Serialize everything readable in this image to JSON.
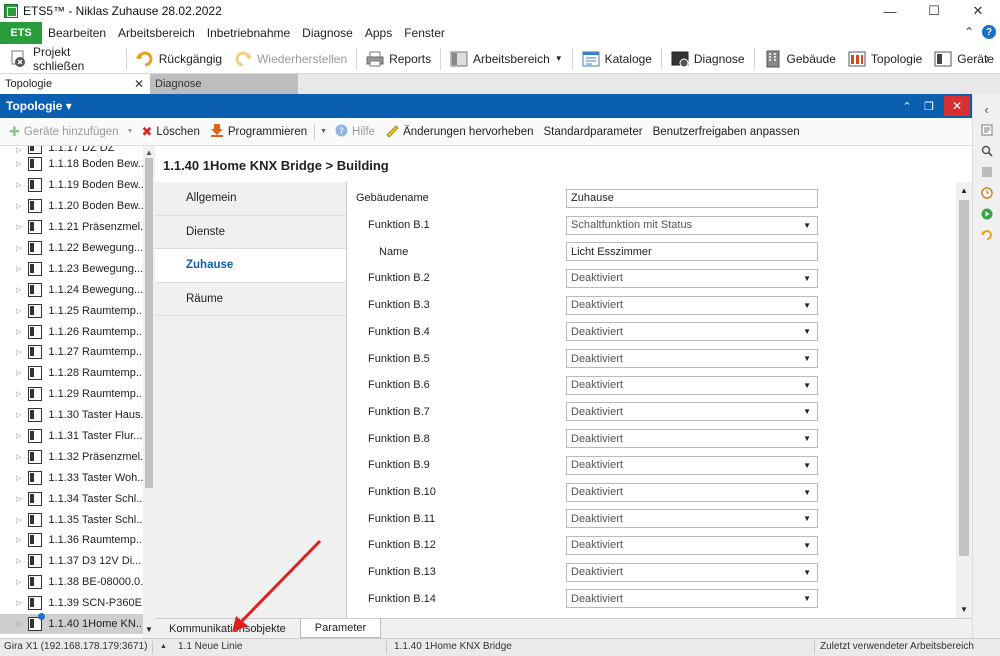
{
  "window": {
    "title": "ETS5™ - Niklas Zuhause 28.02.2022",
    "minimize": "—",
    "maximize": "☐",
    "close": "✕"
  },
  "menu": {
    "ets_tab": "ETS",
    "items": [
      "Bearbeiten",
      "Arbeitsbereich",
      "Inbetriebnahme",
      "Diagnose",
      "Apps",
      "Fenster"
    ],
    "collapse": "⌃",
    "help": "?"
  },
  "ribbon": {
    "close_project": "Projekt schließen",
    "undo": "Rückgängig",
    "redo": "Wiederherstellen",
    "reports": "Reports",
    "workspace": "Arbeitsbereich",
    "catalogs": "Kataloge",
    "diagnose": "Diagnose",
    "buildings": "Gebäude",
    "topology": "Topologie",
    "devices": "Geräte",
    "more": "›"
  },
  "doctabs": {
    "active": "Topologie",
    "active_close": "✕",
    "inactive": "Diagnose"
  },
  "panel": {
    "title": "Topologie ▾",
    "collapse": "⌃",
    "restore": "❐",
    "close": "✕"
  },
  "toolbar": {
    "add_devices": "Geräte hinzufügen",
    "delete": "Löschen",
    "program": "Programmieren",
    "help": "Hilfe",
    "highlight_changes": "Änderungen hervorheben",
    "default_params": "Standardparameter",
    "user_approvals": "Benutzerfreigaben anpassen"
  },
  "tree": {
    "partial_top": "1.1.17 DZ DZ",
    "items": [
      "1.1.18 Boden Bew...",
      "1.1.19 Boden Bew...",
      "1.1.20 Boden Bew...",
      "1.1.21 Präsenzmel...",
      "1.1.22 Bewegung...",
      "1.1.23 Bewegung...",
      "1.1.24 Bewegung...",
      "1.1.25 Raumtemp...",
      "1.1.26 Raumtemp...",
      "1.1.27 Raumtemp...",
      "1.1.28 Raumtemp...",
      "1.1.29 Raumtemp...",
      "1.1.30 Taster Haus...",
      "1.1.31 Taster Flur...",
      "1.1.32 Präsenzmel...",
      "1.1.33 Taster Woh...",
      "1.1.34 Taster Schl...",
      "1.1.35 Taster Schl...",
      "1.1.36 Raumtemp...",
      "1.1.37 D3 12V Di...",
      "1.1.38 BE-08000.0...",
      "1.1.39 SCN-P360E...",
      "1.1.40 1Home KN..."
    ]
  },
  "content": {
    "title": "1.1.40 1Home KNX Bridge > Building",
    "nav": [
      "Allgemein",
      "Dienste",
      "Zuhause",
      "Räume"
    ],
    "params": [
      {
        "label": "Gebäudename",
        "value": "Zuhause",
        "type": "text",
        "indent": 0
      },
      {
        "label": "Funktion B.1",
        "value": "Schaltfunktion mit Status",
        "type": "select",
        "indent": 1
      },
      {
        "label": "Name",
        "value": "Licht Esszimmer",
        "type": "text",
        "indent": 2
      },
      {
        "label": "Funktion B.2",
        "value": "Deaktiviert",
        "type": "select",
        "indent": 1
      },
      {
        "label": "Funktion B.3",
        "value": "Deaktiviert",
        "type": "select",
        "indent": 1
      },
      {
        "label": "Funktion B.4",
        "value": "Deaktiviert",
        "type": "select",
        "indent": 1
      },
      {
        "label": "Funktion B.5",
        "value": "Deaktiviert",
        "type": "select",
        "indent": 1
      },
      {
        "label": "Funktion B.6",
        "value": "Deaktiviert",
        "type": "select",
        "indent": 1
      },
      {
        "label": "Funktion B.7",
        "value": "Deaktiviert",
        "type": "select",
        "indent": 1
      },
      {
        "label": "Funktion B.8",
        "value": "Deaktiviert",
        "type": "select",
        "indent": 1
      },
      {
        "label": "Funktion B.9",
        "value": "Deaktiviert",
        "type": "select",
        "indent": 1
      },
      {
        "label": "Funktion B.10",
        "value": "Deaktiviert",
        "type": "select",
        "indent": 1
      },
      {
        "label": "Funktion B.11",
        "value": "Deaktiviert",
        "type": "select",
        "indent": 1
      },
      {
        "label": "Funktion B.12",
        "value": "Deaktiviert",
        "type": "select",
        "indent": 1
      },
      {
        "label": "Funktion B.13",
        "value": "Deaktiviert",
        "type": "select",
        "indent": 1
      },
      {
        "label": "Funktion B.14",
        "value": "Deaktiviert",
        "type": "select",
        "indent": 1
      }
    ]
  },
  "bottomtabs": {
    "comm_objects": "Kommunikationsobjekte",
    "parameters": "Parameter"
  },
  "status": {
    "interface": "Gira X1 (192.168.178.179:3671)",
    "line": "1.1 Neue Linie",
    "device": "1.1.40 1Home KNX Bridge",
    "workspace": "Zuletzt verwendeter Arbeitsbereich"
  },
  "colors": {
    "accent_blue": "#0a5fb0",
    "ets_green": "#2b9c3b",
    "close_red": "#d63031",
    "annotation_red": "#e0201f"
  }
}
